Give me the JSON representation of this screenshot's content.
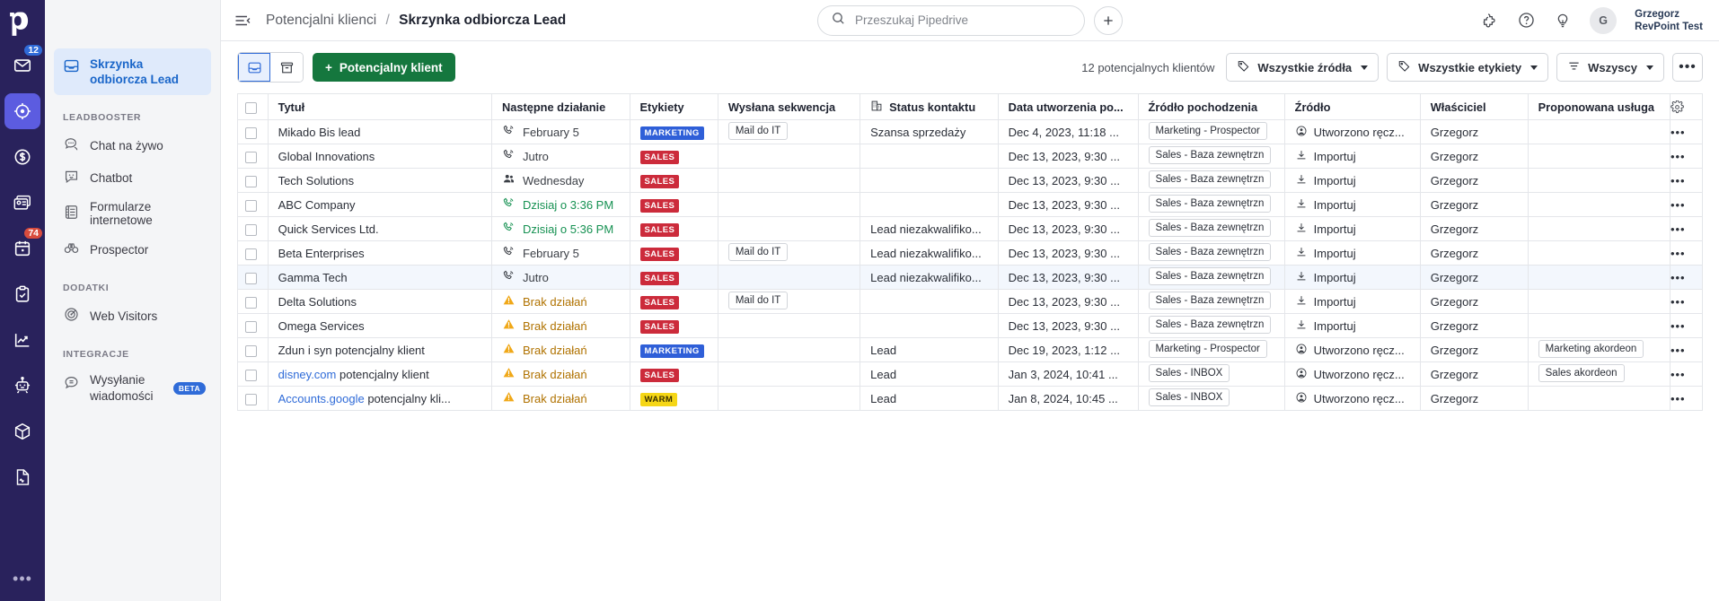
{
  "rail": {
    "logo": "pipedrive-logo",
    "items": [
      {
        "name": "mail",
        "icon": "envelope-icon",
        "badge": "12",
        "badge_color": "blue",
        "active": false
      },
      {
        "name": "leads",
        "icon": "target-icon",
        "badge": null,
        "active": true
      },
      {
        "name": "deals",
        "icon": "dollar-circle-icon",
        "badge": null,
        "active": false
      },
      {
        "name": "contacts",
        "icon": "contact-card-icon",
        "badge": null,
        "active": false
      },
      {
        "name": "activities",
        "icon": "calendar-icon",
        "badge": "74",
        "badge_color": "red",
        "active": false
      },
      {
        "name": "projects",
        "icon": "clipboard-check-icon",
        "badge": null,
        "active": false
      },
      {
        "name": "insights",
        "icon": "chart-line-icon",
        "badge": null,
        "active": false
      },
      {
        "name": "automations",
        "icon": "robot-icon",
        "badge": null,
        "active": false
      },
      {
        "name": "products",
        "icon": "box-icon",
        "badge": null,
        "active": false
      },
      {
        "name": "documents",
        "icon": "document-icon",
        "badge": null,
        "active": false
      }
    ],
    "more": "•••"
  },
  "sidebar": {
    "selected": {
      "label": "Skrzynka odbiorcza Lead",
      "icon": "inbox-icon"
    },
    "groups": [
      {
        "title": "LEADBOOSTER",
        "items": [
          {
            "label": "Chat na żywo",
            "icon": "chat-icon",
            "badge": null
          },
          {
            "label": "Chatbot",
            "icon": "chatbot-icon",
            "badge": null
          },
          {
            "label": "Formularze internetowe",
            "icon": "form-icon",
            "badge": null
          },
          {
            "label": "Prospector",
            "icon": "binoculars-icon",
            "badge": null
          }
        ]
      },
      {
        "title": "DODATKI",
        "items": [
          {
            "label": "Web Visitors",
            "icon": "radar-icon",
            "badge": null
          }
        ]
      },
      {
        "title": "INTEGRACJE",
        "items": [
          {
            "label": "Wysyłanie wiadomości",
            "icon": "message-icon",
            "badge": "BETA"
          }
        ]
      }
    ]
  },
  "topbar": {
    "menu_icon": "hamburger-icon",
    "breadcrumb_parent": "Potencjalni klienci",
    "breadcrumb_sep": "/",
    "breadcrumb_current": "Skrzynka odbiorcza Lead",
    "search_placeholder": "Przeszukaj Pipedrive",
    "search_value": "",
    "search_icon": "search-icon",
    "add_icon": "plus-icon",
    "icons": [
      "puzzle-icon",
      "help-circle-icon",
      "lightbulb-icon"
    ],
    "avatar_initial": "G",
    "user_name": "Grzegorz",
    "user_org": "RevPoint Test"
  },
  "toolbar": {
    "view_inbox_icon": "inbox-icon",
    "view_archive_icon": "archive-icon",
    "add_lead_label": "Potencjalny klient",
    "add_lead_plus": "+",
    "count_label": "12 potencjalnych klientów",
    "filters": [
      {
        "label": "Wszystkie źródła",
        "icon": "tag-icon"
      },
      {
        "label": "Wszystkie etykiety",
        "icon": "tag-icon"
      },
      {
        "label": "Wszyscy",
        "icon": "filter-icon"
      }
    ],
    "more_label": "•••"
  },
  "table": {
    "columns": [
      {
        "label": "Tytuł",
        "icon": null
      },
      {
        "label": "Następne działanie",
        "icon": null
      },
      {
        "label": "Etykiety",
        "icon": null
      },
      {
        "label": "Wysłana sekwencja",
        "icon": null
      },
      {
        "label": "Status kontaktu",
        "icon": "org-icon"
      },
      {
        "label": "Data utworzenia po...",
        "icon": null
      },
      {
        "label": "Źródło pochodzenia",
        "icon": null
      },
      {
        "label": "Źródło",
        "icon": null
      },
      {
        "label": "Właściciel",
        "icon": null
      },
      {
        "label": "Proponowana usługa",
        "icon": null
      }
    ],
    "settings_icon": "gear-icon",
    "row_menu": "•••",
    "rows": [
      {
        "title": "Mikado Bis lead",
        "title_link": null,
        "next_action": "February 5",
        "next_action_icon": "phone-icon",
        "next_action_state": "gray",
        "label": "MARKETING",
        "label_kind": "marketing",
        "sequence": "Mail do IT",
        "contact_status": "Szansa sprzedaży",
        "created": "Dec 4, 2023, 11:18 ...",
        "origin": "Marketing - Prospector",
        "source": "Utworzono ręcz...",
        "source_icon": "person-circle-icon",
        "owner": "Grzegorz",
        "service": "",
        "zebra": false
      },
      {
        "title": "Global Innovations",
        "title_link": null,
        "next_action": "Jutro",
        "next_action_icon": "phone-icon",
        "next_action_state": "gray",
        "label": "SALES",
        "label_kind": "sales",
        "sequence": "",
        "contact_status": "",
        "created": "Dec 13, 2023, 9:30 ...",
        "origin": "Sales - Baza zewnętrzn",
        "source": "Importuj",
        "source_icon": "download-icon",
        "owner": "Grzegorz",
        "service": "",
        "zebra": false
      },
      {
        "title": "Tech Solutions",
        "title_link": null,
        "next_action": "Wednesday",
        "next_action_icon": "people-icon",
        "next_action_state": "gray",
        "label": "SALES",
        "label_kind": "sales",
        "sequence": "",
        "contact_status": "",
        "created": "Dec 13, 2023, 9:30 ...",
        "origin": "Sales - Baza zewnętrzn",
        "source": "Importuj",
        "source_icon": "download-icon",
        "owner": "Grzegorz",
        "service": "",
        "zebra": false
      },
      {
        "title": "ABC Company",
        "title_link": null,
        "next_action": "Dzisiaj o 3:36 PM",
        "next_action_icon": "phone-icon",
        "next_action_state": "green",
        "label": "SALES",
        "label_kind": "sales",
        "sequence": "",
        "contact_status": "",
        "created": "Dec 13, 2023, 9:30 ...",
        "origin": "Sales - Baza zewnętrzn",
        "source": "Importuj",
        "source_icon": "download-icon",
        "owner": "Grzegorz",
        "service": "",
        "zebra": false
      },
      {
        "title": "Quick Services Ltd.",
        "title_link": null,
        "next_action": "Dzisiaj o 5:36 PM",
        "next_action_icon": "phone-icon",
        "next_action_state": "green",
        "label": "SALES",
        "label_kind": "sales",
        "sequence": "",
        "contact_status": "Lead niezakwalifiko...",
        "created": "Dec 13, 2023, 9:30 ...",
        "origin": "Sales - Baza zewnętrzn",
        "source": "Importuj",
        "source_icon": "download-icon",
        "owner": "Grzegorz",
        "service": "",
        "zebra": false
      },
      {
        "title": "Beta Enterprises",
        "title_link": null,
        "next_action": "February 5",
        "next_action_icon": "phone-icon",
        "next_action_state": "gray",
        "label": "SALES",
        "label_kind": "sales",
        "sequence": "Mail do IT",
        "contact_status": "Lead niezakwalifiko...",
        "created": "Dec 13, 2023, 9:30 ...",
        "origin": "Sales - Baza zewnętrzn",
        "source": "Importuj",
        "source_icon": "download-icon",
        "owner": "Grzegorz",
        "service": "",
        "zebra": false
      },
      {
        "title": "Gamma Tech",
        "title_link": null,
        "next_action": "Jutro",
        "next_action_icon": "phone-icon",
        "next_action_state": "gray",
        "label": "SALES",
        "label_kind": "sales",
        "sequence": "",
        "contact_status": "Lead niezakwalifiko...",
        "created": "Dec 13, 2023, 9:30 ...",
        "origin": "Sales - Baza zewnętrzn",
        "source": "Importuj",
        "source_icon": "download-icon",
        "owner": "Grzegorz",
        "service": "",
        "zebra": true
      },
      {
        "title": "Delta Solutions",
        "title_link": null,
        "next_action": "Brak działań",
        "next_action_icon": "warning-icon",
        "next_action_state": "warn",
        "label": "SALES",
        "label_kind": "sales",
        "sequence": "Mail do IT",
        "contact_status": "",
        "created": "Dec 13, 2023, 9:30 ...",
        "origin": "Sales - Baza zewnętrzn",
        "source": "Importuj",
        "source_icon": "download-icon",
        "owner": "Grzegorz",
        "service": "",
        "zebra": false
      },
      {
        "title": "Omega Services",
        "title_link": null,
        "next_action": "Brak działań",
        "next_action_icon": "warning-icon",
        "next_action_state": "warn",
        "label": "SALES",
        "label_kind": "sales",
        "sequence": "",
        "contact_status": "",
        "created": "Dec 13, 2023, 9:30 ...",
        "origin": "Sales - Baza zewnętrzn",
        "source": "Importuj",
        "source_icon": "download-icon",
        "owner": "Grzegorz",
        "service": "",
        "zebra": false
      },
      {
        "title": "Zdun i syn potencjalny klient",
        "title_link": null,
        "next_action": "Brak działań",
        "next_action_icon": "warning-icon",
        "next_action_state": "warn",
        "label": "MARKETING",
        "label_kind": "marketing",
        "sequence": "",
        "contact_status": "Lead",
        "created": "Dec 19, 2023, 1:12 ...",
        "origin": "Marketing - Prospector",
        "source": "Utworzono ręcz...",
        "source_icon": "person-circle-icon",
        "owner": "Grzegorz",
        "service": "Marketing akordeon",
        "zebra": false
      },
      {
        "title": " potencjalny klient",
        "title_link": "disney.com",
        "next_action": "Brak działań",
        "next_action_icon": "warning-icon",
        "next_action_state": "warn",
        "label": "SALES",
        "label_kind": "sales",
        "sequence": "",
        "contact_status": "Lead",
        "created": "Jan 3, 2024, 10:41 ...",
        "origin": "Sales - INBOX",
        "source": "Utworzono ręcz...",
        "source_icon": "person-circle-icon",
        "owner": "Grzegorz",
        "service": "Sales akordeon",
        "zebra": false
      },
      {
        "title": " potencjalny kli...",
        "title_link": "Accounts.google",
        "next_action": "Brak działań",
        "next_action_icon": "warning-icon",
        "next_action_state": "warn",
        "label": "WARM",
        "label_kind": "warm",
        "sequence": "",
        "contact_status": "Lead",
        "created": "Jan 8, 2024, 10:45 ...",
        "origin": "Sales - INBOX",
        "source": "Utworzono ręcz...",
        "source_icon": "person-circle-icon",
        "owner": "Grzegorz",
        "service": "",
        "zebra": false
      }
    ]
  },
  "colors": {
    "rail_bg": "#29225c",
    "rail_active": "#5c5ce0",
    "primary_green": "#15773e",
    "link_blue": "#2f6bd8",
    "selected_bg": "#dfeafb",
    "tag_marketing": "#2f5fd8",
    "tag_sales": "#cc2b3b",
    "tag_warm": "#f5d616",
    "action_green": "#169152",
    "action_warn": "#b07200"
  }
}
